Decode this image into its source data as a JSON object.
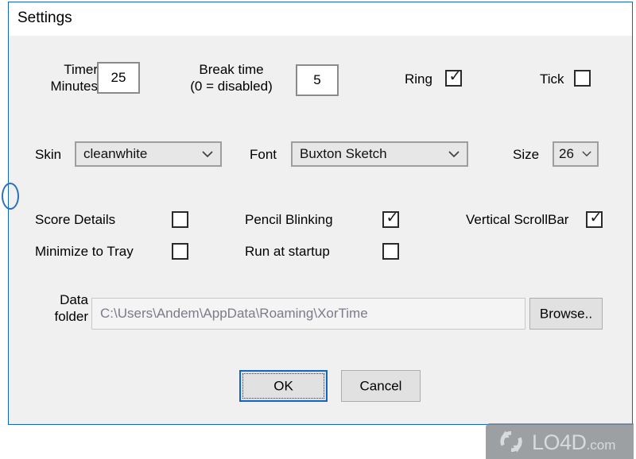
{
  "window": {
    "title": "Settings",
    "accent_color": "#0f65c0",
    "panel_color": "#f0f0f0",
    "titlebar_color": "#ffffff"
  },
  "timer": {
    "label_line1": "Timer",
    "label_line2": "Minutes",
    "value": "25"
  },
  "break_time": {
    "label_line1": "Break time",
    "label_line2": "(0 = disabled)",
    "value": "5"
  },
  "ring": {
    "label": "Ring",
    "checked": true,
    "state_glyph": "✓"
  },
  "tick": {
    "label": "Tick",
    "checked": false,
    "state_glyph": "✓"
  },
  "skin": {
    "label": "Skin",
    "value": "cleanwhite"
  },
  "font": {
    "label": "Font",
    "value": "Buxton Sketch"
  },
  "size": {
    "label": "Size",
    "value": "26"
  },
  "score_details": {
    "label": "Score Details",
    "checked": false,
    "state_glyph": "✓"
  },
  "minimize_to_tray": {
    "label": "Minimize to Tray",
    "checked": false,
    "state_glyph": "✓"
  },
  "pencil_blinking": {
    "label": "Pencil Blinking",
    "checked": true,
    "state_glyph": "✓"
  },
  "run_at_startup": {
    "label": "Run at startup",
    "checked": false,
    "state_glyph": "✓"
  },
  "vertical_scrollbar": {
    "label": "Vertical ScrollBar",
    "checked": true,
    "state_glyph": "✓"
  },
  "data_folder": {
    "label_line1": "Data",
    "label_line2": "folder",
    "value": "C:\\Users\\Andem\\AppData\\Roaming\\XorTime",
    "browse_label": "Browse.."
  },
  "buttons": {
    "ok_label": "OK",
    "cancel_label": "Cancel"
  },
  "watermark": {
    "brand": "LO4D",
    "suffix": ".com"
  }
}
